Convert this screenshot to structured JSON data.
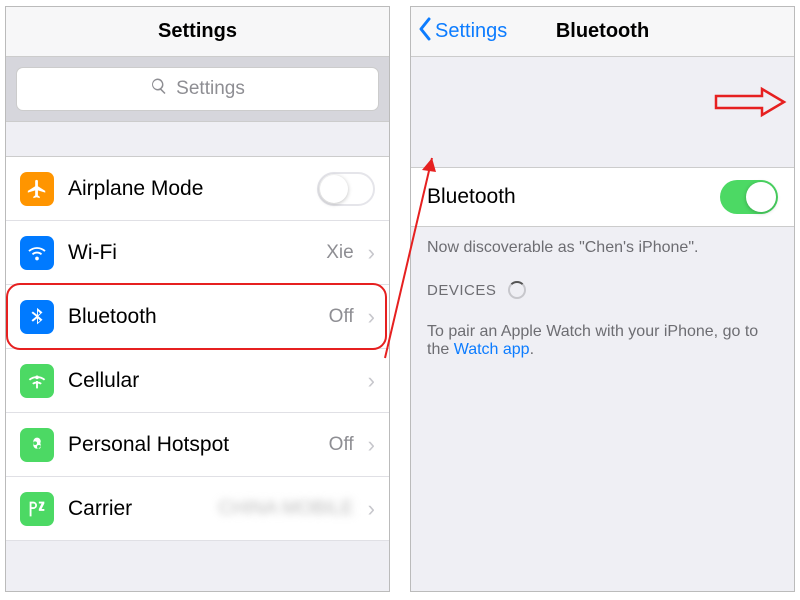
{
  "left": {
    "title": "Settings",
    "search_placeholder": "Settings",
    "rows": [
      {
        "key": "airplane",
        "label": "Airplane Mode",
        "value": "",
        "icon_bg": "#ff9500"
      },
      {
        "key": "wifi",
        "label": "Wi-Fi",
        "value": "Xie",
        "icon_bg": "#007aff"
      },
      {
        "key": "bluetooth",
        "label": "Bluetooth",
        "value": "Off",
        "icon_bg": "#007aff",
        "highlight": true
      },
      {
        "key": "cellular",
        "label": "Cellular",
        "value": "",
        "icon_bg": "#4cd964"
      },
      {
        "key": "hotspot",
        "label": "Personal Hotspot",
        "value": "Off",
        "icon_bg": "#4cd964"
      },
      {
        "key": "carrier",
        "label": "Carrier",
        "value": "CHINA MOBILE",
        "icon_bg": "#4cd964"
      }
    ]
  },
  "right": {
    "back_label": "Settings",
    "title": "Bluetooth",
    "toggle_label": "Bluetooth",
    "toggle_on": true,
    "discoverable": "Now discoverable as \"Chen's iPhone\".",
    "devices_title": "DEVICES",
    "pairing_text_a": "To pair an Apple Watch with your iPhone, go to the ",
    "pairing_link": "Watch app",
    "pairing_text_b": "."
  }
}
